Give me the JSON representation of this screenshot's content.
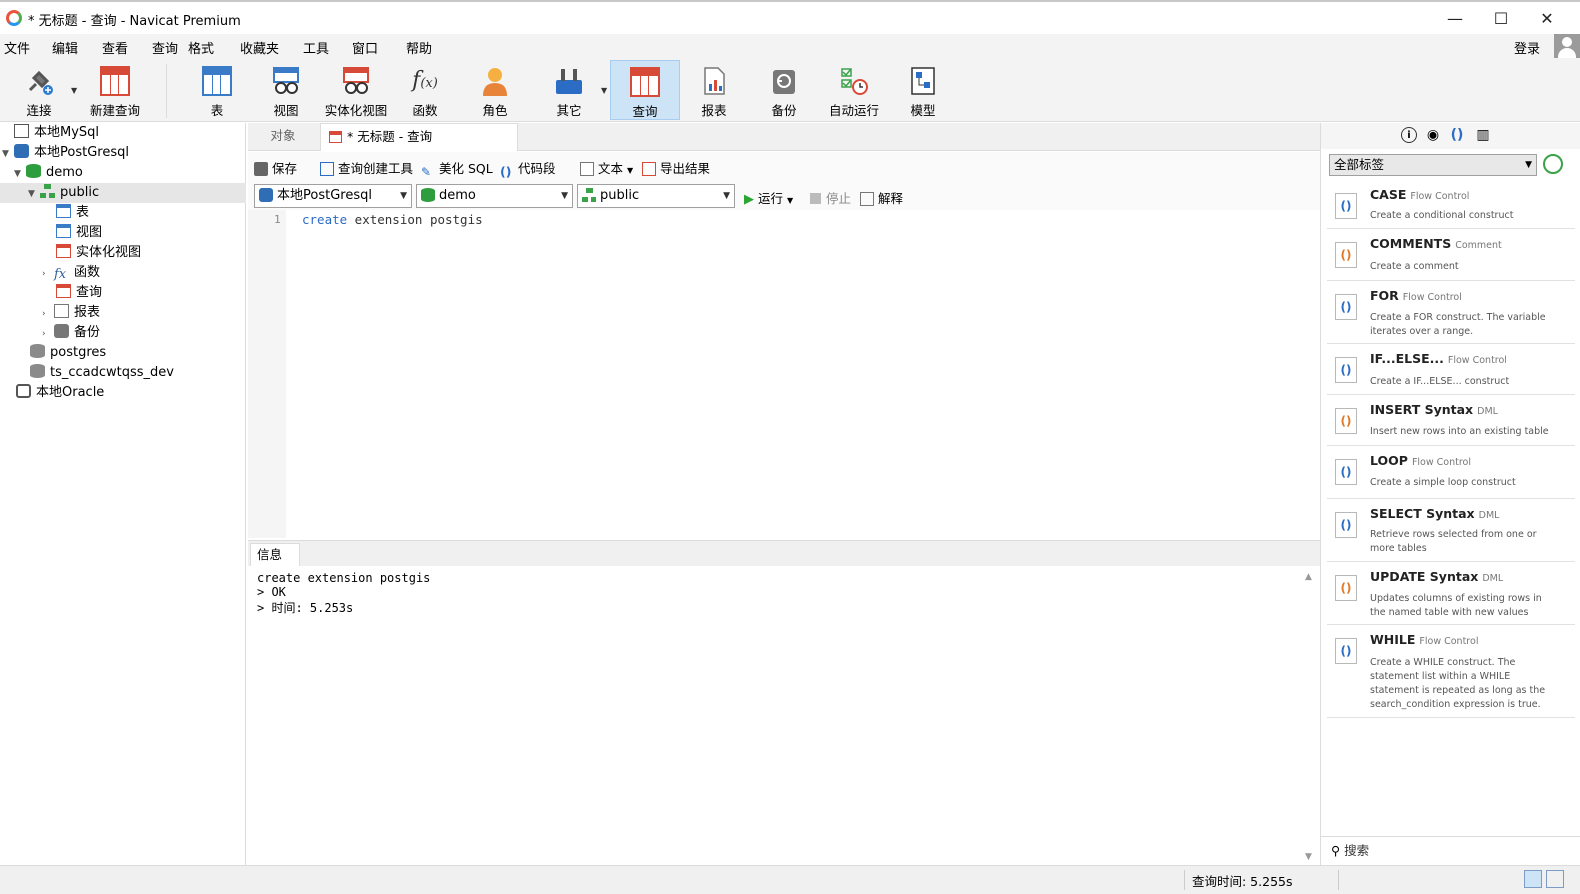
{
  "window": {
    "title": "* 无标题 - 查询 - Navicat Premium",
    "minimize": "—",
    "maximize": "☐",
    "close": "✕"
  },
  "menu": [
    "文件",
    "编辑",
    "查看",
    "查询",
    "格式",
    "收藏夹",
    "工具",
    "窗口",
    "帮助"
  ],
  "login": "登录",
  "toolbar": [
    "连接",
    "新建查询",
    "表",
    "视图",
    "实体化视图",
    "函数",
    "角色",
    "其它",
    "查询",
    "报表",
    "备份",
    "自动运行",
    "模型"
  ],
  "tree": {
    "conn_mysql": "本地MySql",
    "conn_pg": "本地PostGresql",
    "db_demo": "demo",
    "schema_public": "public",
    "items": [
      "表",
      "视图",
      "实体化视图",
      "函数",
      "查询",
      "报表",
      "备份"
    ],
    "db_postgres": "postgres",
    "db_ts": "ts_ccadcwtqss_dev",
    "conn_oracle": "本地Oracle"
  },
  "tabs": {
    "objects": "对象",
    "query": "* 无标题 - 查询"
  },
  "query_toolbar": {
    "save": "保存",
    "builder": "查询创建工具",
    "beautify": "美化 SQL",
    "snippet": "代码段",
    "text": "文本",
    "export": "导出结果"
  },
  "selectors": {
    "connection": "本地PostGresql",
    "database": "demo",
    "schema": "public",
    "run": "运行",
    "stop": "停止",
    "explain": "解释"
  },
  "editor": {
    "line": "1",
    "keyword": "create",
    "rest": " extension postgis"
  },
  "messages": {
    "tab": "信息",
    "lines": [
      "create extension postgis",
      "> OK",
      "> 时间: 5.253s"
    ]
  },
  "right_panel": {
    "tag_filter": "全部标签",
    "search": "搜索",
    "snippets": [
      {
        "name": "CASE",
        "tag": "Flow Control",
        "desc": "Create a conditional construct"
      },
      {
        "name": "COMMENTS",
        "tag": "Comment",
        "desc": "Create a comment"
      },
      {
        "name": "FOR",
        "tag": "Flow Control",
        "desc": "Create a FOR construct. The variable iterates over a range."
      },
      {
        "name": "IF...ELSE...",
        "tag": "Flow Control",
        "desc": "Create a IF...ELSE... construct"
      },
      {
        "name": "INSERT Syntax",
        "tag": "DML",
        "desc": "Insert new rows into an existing table"
      },
      {
        "name": "LOOP",
        "tag": "Flow Control",
        "desc": "Create a simple loop construct"
      },
      {
        "name": "SELECT Syntax",
        "tag": "DML",
        "desc": "Retrieve rows selected from one or more tables"
      },
      {
        "name": "UPDATE Syntax",
        "tag": "DML",
        "desc": "Updates columns of existing rows in the named table with new values"
      },
      {
        "name": "WHILE",
        "tag": "Flow Control",
        "desc": "Create a WHILE construct. The statement list within a WHILE statement is repeated as long as the search_condition expression is true."
      }
    ]
  },
  "status": {
    "query_time": "查询时间: 5.255s"
  }
}
